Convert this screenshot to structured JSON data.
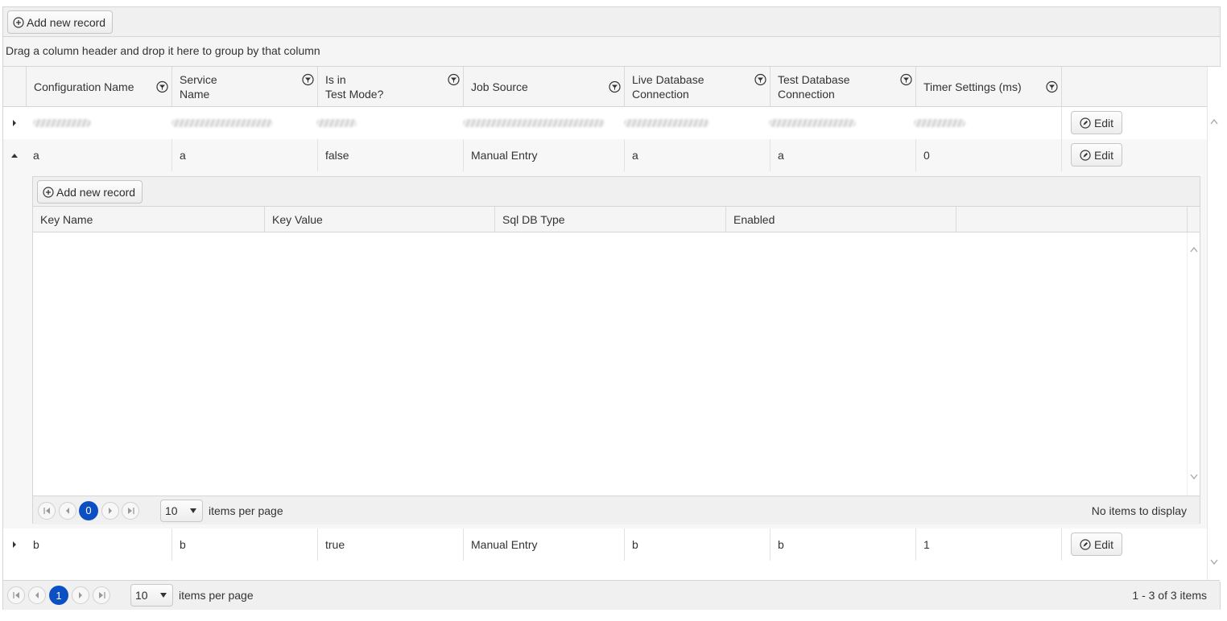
{
  "toolbar": {
    "add_label": "Add new record"
  },
  "grouping": {
    "hint": "Drag a column header and drop it here to group by that column"
  },
  "columns": [
    {
      "line1": "Configuration Name",
      "line2": ""
    },
    {
      "line1": "Service",
      "line2": "Name"
    },
    {
      "line1": "Is in",
      "line2": "Test Mode?"
    },
    {
      "line1": "Job Source",
      "line2": ""
    },
    {
      "line1": "Live Database",
      "line2": "Connection"
    },
    {
      "line1": "Test Database",
      "line2": "Connection"
    },
    {
      "line1": "Timer Settings (ms)",
      "line2": ""
    }
  ],
  "rows": [
    {
      "expanded": false,
      "redacted": true,
      "cells": [
        "",
        "",
        "",
        "",
        "",
        "",
        ""
      ],
      "edit_label": "Edit"
    },
    {
      "expanded": true,
      "redacted": false,
      "cells": [
        "a",
        "a",
        "false",
        "Manual Entry",
        "a",
        "a",
        "0"
      ],
      "edit_label": "Edit"
    },
    {
      "expanded": false,
      "redacted": false,
      "cells": [
        "b",
        "b",
        "true",
        "Manual Entry",
        "b",
        "b",
        "1"
      ],
      "edit_label": "Edit"
    }
  ],
  "detail": {
    "add_label": "Add new record",
    "columns": [
      "Key Name",
      "Key Value",
      "Sql DB Type",
      "Enabled"
    ],
    "pager": {
      "current_page": "0",
      "page_size": "10",
      "items_per_page_label": "items per page",
      "info": "No items to display"
    }
  },
  "pager": {
    "current_page": "1",
    "page_size": "10",
    "items_per_page_label": "items per page",
    "info": "1 - 3 of 3 items"
  },
  "colors": {
    "accent": "#0b4fc3",
    "header_bg": "#f5f5f5",
    "toolbar_bg": "#f0f0f0"
  }
}
